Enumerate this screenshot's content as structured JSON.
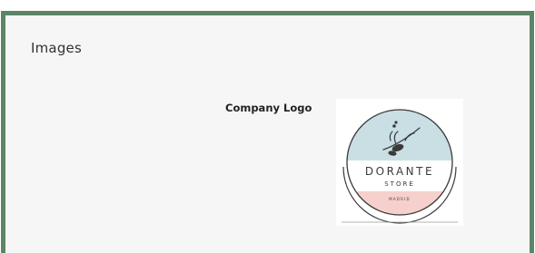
{
  "section": {
    "title": "Images"
  },
  "company_logo": {
    "label": "Company Logo",
    "logo_brand": "DORANTE",
    "logo_sub": "STORE",
    "logo_city": "MADRID"
  },
  "colors": {
    "frame_border": "#5c8566",
    "panel_background": "#f6f6f6",
    "logo_top_band": "#c9dfe3",
    "logo_bottom_band": "#f6d0cc",
    "logo_ink": "#3a3a3a"
  }
}
